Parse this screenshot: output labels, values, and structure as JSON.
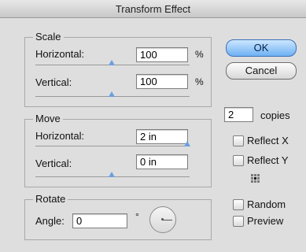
{
  "window": {
    "title": "Transform Effect"
  },
  "scale": {
    "legend": "Scale",
    "horizontal": {
      "label": "Horizontal:",
      "value": "100",
      "unit": "%",
      "slider": 0.5
    },
    "vertical": {
      "label": "Vertical:",
      "value": "100",
      "unit": "%",
      "slider": 0.5
    }
  },
  "move": {
    "legend": "Move",
    "horizontal": {
      "label": "Horizontal:",
      "value": "2 in",
      "slider": 1.0
    },
    "vertical": {
      "label": "Vertical:",
      "value": "0 in",
      "slider": 0.5
    }
  },
  "rotate": {
    "legend": "Rotate",
    "angle_label": "Angle:",
    "angle_value": "0",
    "degree_symbol": "°"
  },
  "buttons": {
    "ok": "OK",
    "cancel": "Cancel"
  },
  "copies": {
    "value": "2",
    "label": "copies"
  },
  "options": {
    "reflect_x": {
      "label": "Reflect X",
      "checked": false
    },
    "reflect_y": {
      "label": "Reflect Y",
      "checked": false
    },
    "random": {
      "label": "Random",
      "checked": false
    },
    "preview": {
      "label": "Preview",
      "checked": false
    }
  },
  "reference_point": {
    "selected": "center"
  },
  "colors": {
    "slider_thumb": "#6aa0e0",
    "ok_button": "#6fb1f3"
  }
}
